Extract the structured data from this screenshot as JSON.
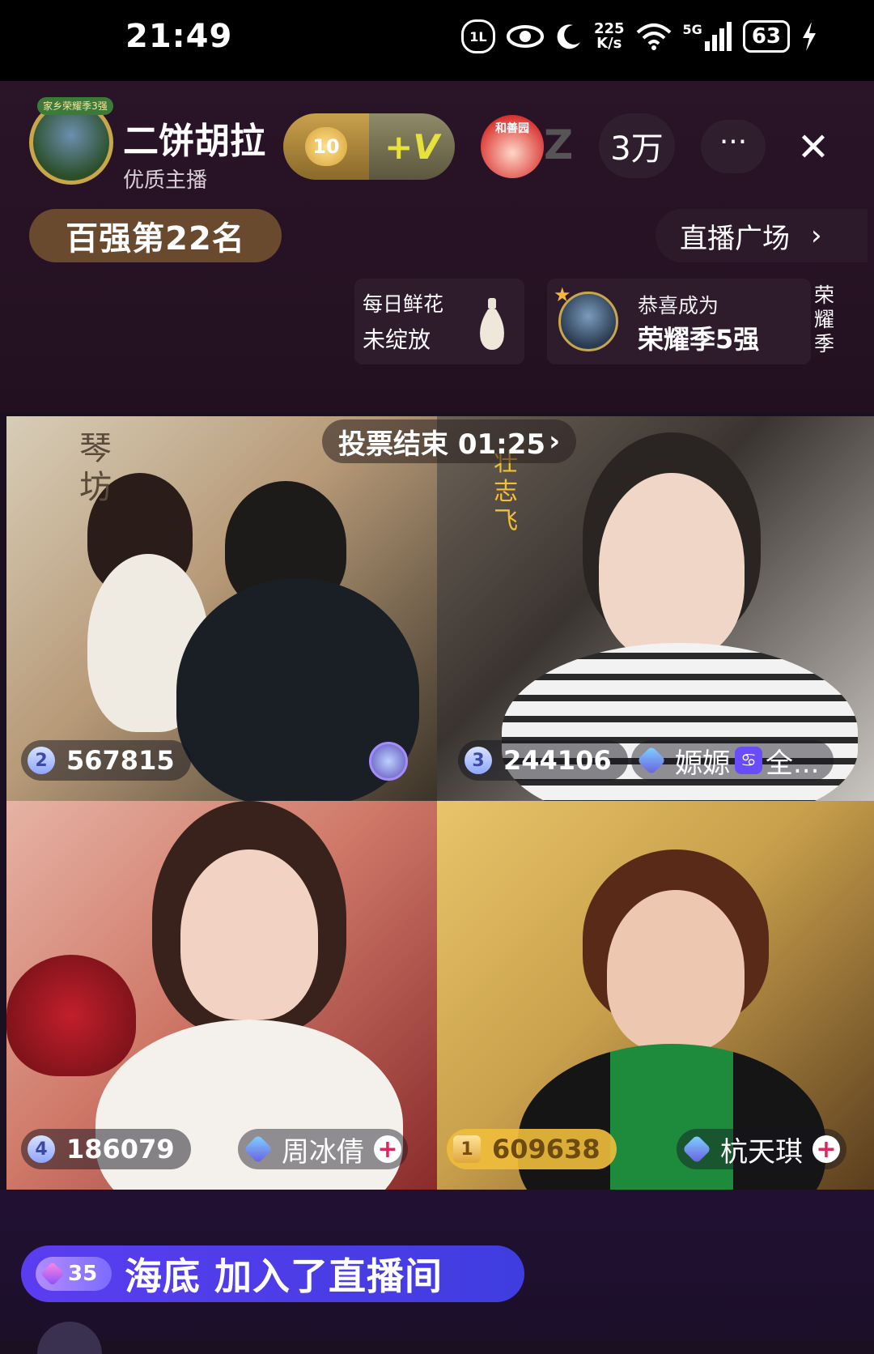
{
  "status_bar": {
    "time": "21:49",
    "hd_badge": "1L",
    "speed_top": "225",
    "speed_bottom": "K/s",
    "network": "5G",
    "battery": "63"
  },
  "host": {
    "avatar_badge": "家乡荣耀季3强",
    "name": "二饼胡拉",
    "tag": "优质主播",
    "level": "10",
    "vip_label": "+V",
    "brand_label": "和善园"
  },
  "header": {
    "viewer_count": "3万",
    "more_label": "···",
    "close_label": "✕",
    "rank_label": "百强第22名",
    "plaza_label": "直播广场",
    "plaza_chevron": "›"
  },
  "cards": {
    "flower_line1": "每日鲜花",
    "flower_line2": "未绽放",
    "honor_line1": "恭喜成为",
    "honor_line2": "荣耀季5强",
    "honor_side": "荣耀季"
  },
  "pk": {
    "vote_timer": "投票结束 01:25",
    "vote_chevron": "›",
    "tiles": [
      {
        "rank": "2",
        "score": "567815"
      },
      {
        "rank": "3",
        "score": "244106",
        "name": "嫄嫄",
        "sign": "♋",
        "extra": "全..."
      },
      {
        "rank": "4",
        "score": "186079",
        "name": "周冰倩"
      },
      {
        "rank": "1",
        "score": "609638",
        "name": "杭天琪"
      }
    ]
  },
  "banner": {
    "level": "35",
    "text": "海底 加入了直播间"
  },
  "colors": {
    "background": "#1b0f22",
    "banner": "#4a3de8",
    "rank_pill": "#6a4a2e",
    "gold": "#f0be3c"
  }
}
